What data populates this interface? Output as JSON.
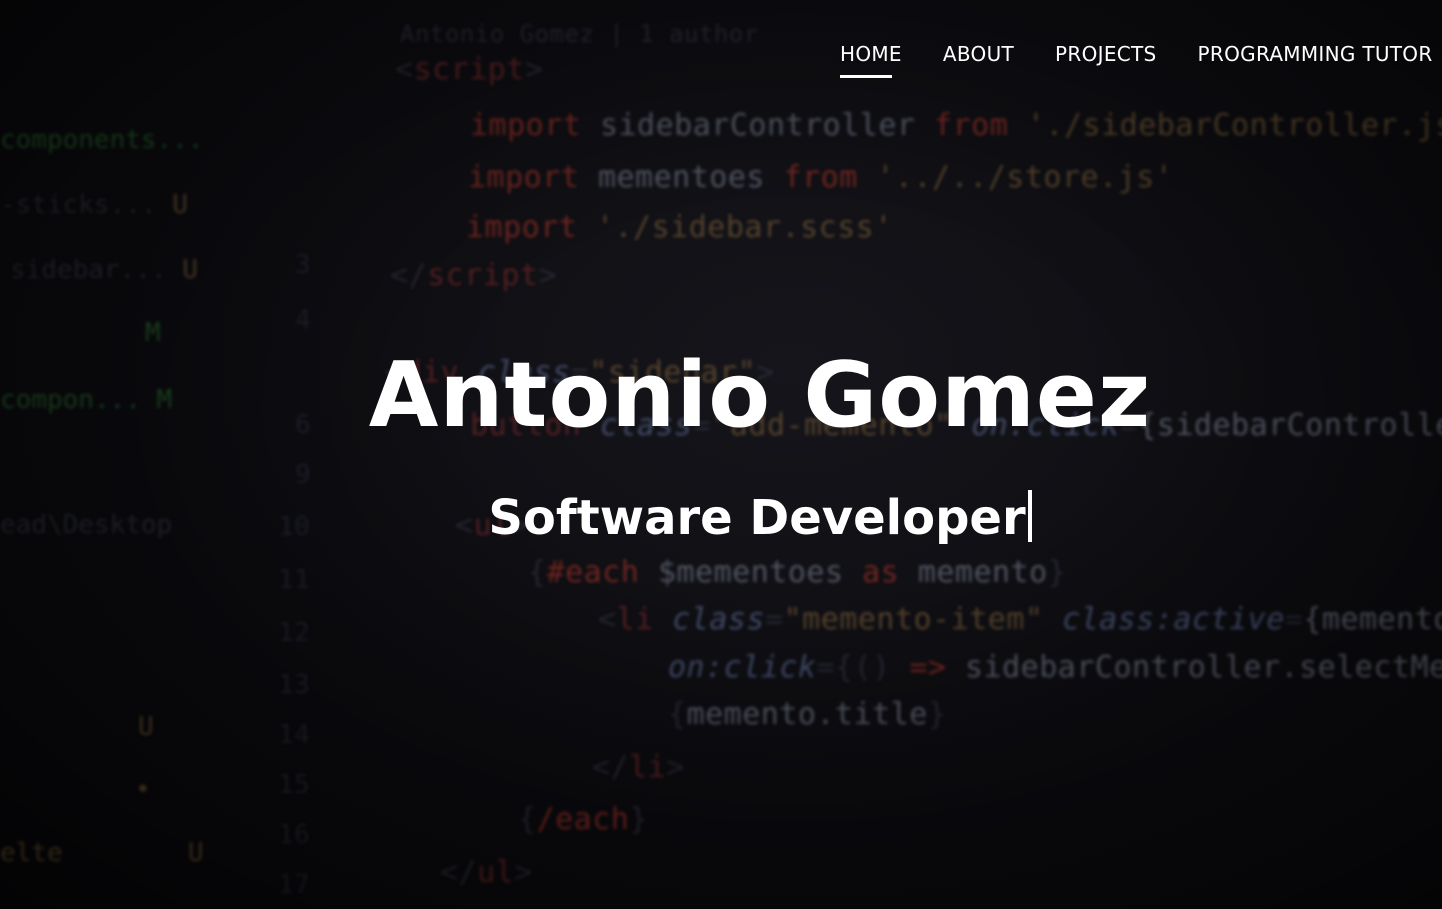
{
  "nav": {
    "items": [
      {
        "label": "HOME",
        "active": true
      },
      {
        "label": "ABOUT",
        "active": false
      },
      {
        "label": "PROJECTS",
        "active": false
      },
      {
        "label": "PROGRAMMING TUTOR",
        "active": false
      }
    ]
  },
  "hero": {
    "name": "Antonio Gomez",
    "role": "Software Developer"
  },
  "colors": {
    "text": "#ffffff",
    "background": "#0a0a0d"
  }
}
